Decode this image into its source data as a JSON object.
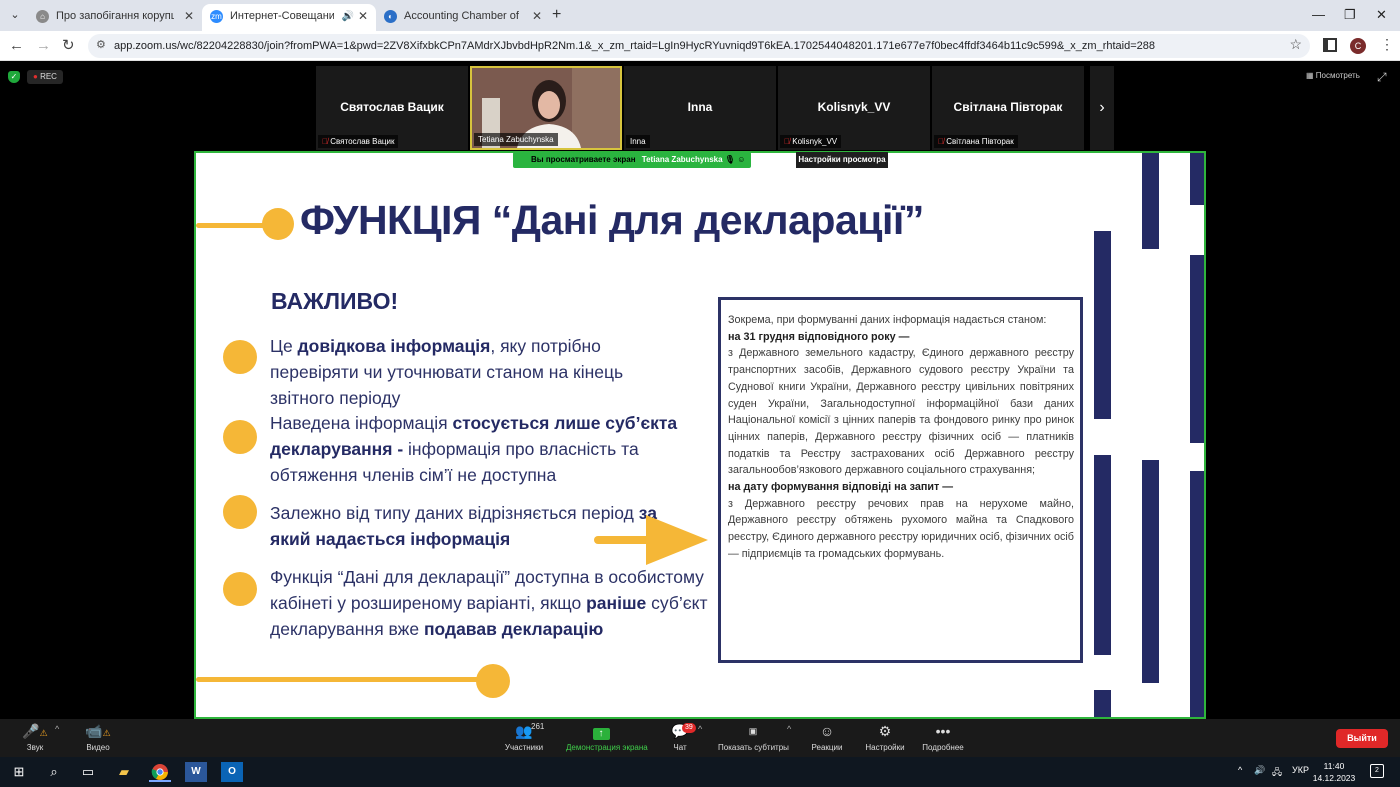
{
  "browser": {
    "tabs": [
      {
        "title": "Про запобігання корупції | від",
        "favicon": "building-icon"
      },
      {
        "title": "Интернет-Совещание Zoom",
        "favicon": "zoom-icon",
        "active": true
      },
      {
        "title": "Accounting Chamber of Ukraine",
        "favicon": "accounting-chamber-icon"
      }
    ],
    "url": "app.zoom.us/wc/82204228830/join?fromPWA=1&pwd=2ZV8XifxbkCPn7AMdrXJbvbdHpR2Nm.1&_x_zm_rtaid=LgIn9HycRYuvniqd9T6kEA.1702544048201.171e677e7f0bec4ffdf3464b11c9c599&_x_zm_rhtaid=288",
    "profile_initial": "C"
  },
  "zoom": {
    "rec_label": "REC",
    "view_button": "Посмотреть",
    "participants_strip": [
      {
        "display": "Святослав Вацик",
        "label": "Святослав Вацик",
        "muted": true
      },
      {
        "display": "",
        "label": "Tetiana Zabuchynska",
        "muted": false,
        "speaking": true
      },
      {
        "display": "Inna",
        "label": "Inna",
        "muted": false
      },
      {
        "display": "Kolisnyk_VV",
        "label": "Kolisnyk_VV",
        "muted": true
      },
      {
        "display": "Світлана Півторак",
        "label": "Світлана Півторак",
        "muted": true
      }
    ],
    "banner": {
      "text": "Вы просматриваете экран",
      "presenter": "Tetiana Zabuchynska",
      "view_settings": "Настройки просмотра"
    },
    "toolbar": {
      "audio": "Звук",
      "video": "Видео",
      "participants": "Участники",
      "participants_count": "261",
      "share": "Демонстрация экрана",
      "chat": "Чат",
      "chat_badge": "39",
      "captions": "Показать субтитры",
      "reactions": "Реакции",
      "settings": "Настройки",
      "more": "Подробнее",
      "leave": "Выйти"
    }
  },
  "slide": {
    "title": "ФУНКЦІЯ “Дані для декларації”",
    "important": "ВАЖЛИВО!",
    "bullets": [
      {
        "a": "Це ",
        "b": "довідкова інформація",
        "c": ", яку потрібно перевіряти чи уточнювати станом на кінець звітного періоду"
      },
      {
        "a": "Наведена інформація ",
        "b": "стосується лише суб’єкта декларування -",
        "c": " інформація про власність та обтяження членів сім’ї не доступна"
      },
      {
        "a": "Залежно від типу даних відрізняється період ",
        "b": "за який надається інформація",
        "c": ""
      },
      {
        "a": "Функція “Дані для декларації” доступна в особистому кабінеті у розширеному варіанті, якщо ",
        "b": "раніше",
        "c": " суб’єкт декларування вже ",
        "d": "подавав декларацію"
      }
    ],
    "box": {
      "lead": "Зокрема, при формуванні даних інформація надається станом:",
      "h1": "на 31 грудня відповідного року —",
      "p1": "з Державного земельного кадастру, Єдиного державного реєстру транспортних засобів, Державного судового реєстру України та Суднової книги України, Державного реєстру цивільних повітряних суден України, Загальнодоступної інформаційної бази даних Національної комісії з цінних паперів та фондового ринку про ринок цінних паперів, Державного реєстру фізичних осіб — платників податків та Реєстру застрахованих осіб Державного реєстру загальнообов’язкового державного соціального страхування;",
      "h2": "на дату формування відповіді на запит —",
      "p2": "з Державного реєстру речових прав на нерухоме майно, Державного реєстру обтяжень рухомого майна та Спадкового реєстру, Єдиного державного реєстру юридичних осіб, фізичних осіб — підприємців та громадських формувань."
    },
    "colors": {
      "navy": "#242a64",
      "accent": "#f5b737",
      "share_border": "#2fb53c"
    }
  },
  "taskbar": {
    "language": "УКР",
    "time": "11:40",
    "date": "14.12.2023",
    "notifications": "2"
  }
}
